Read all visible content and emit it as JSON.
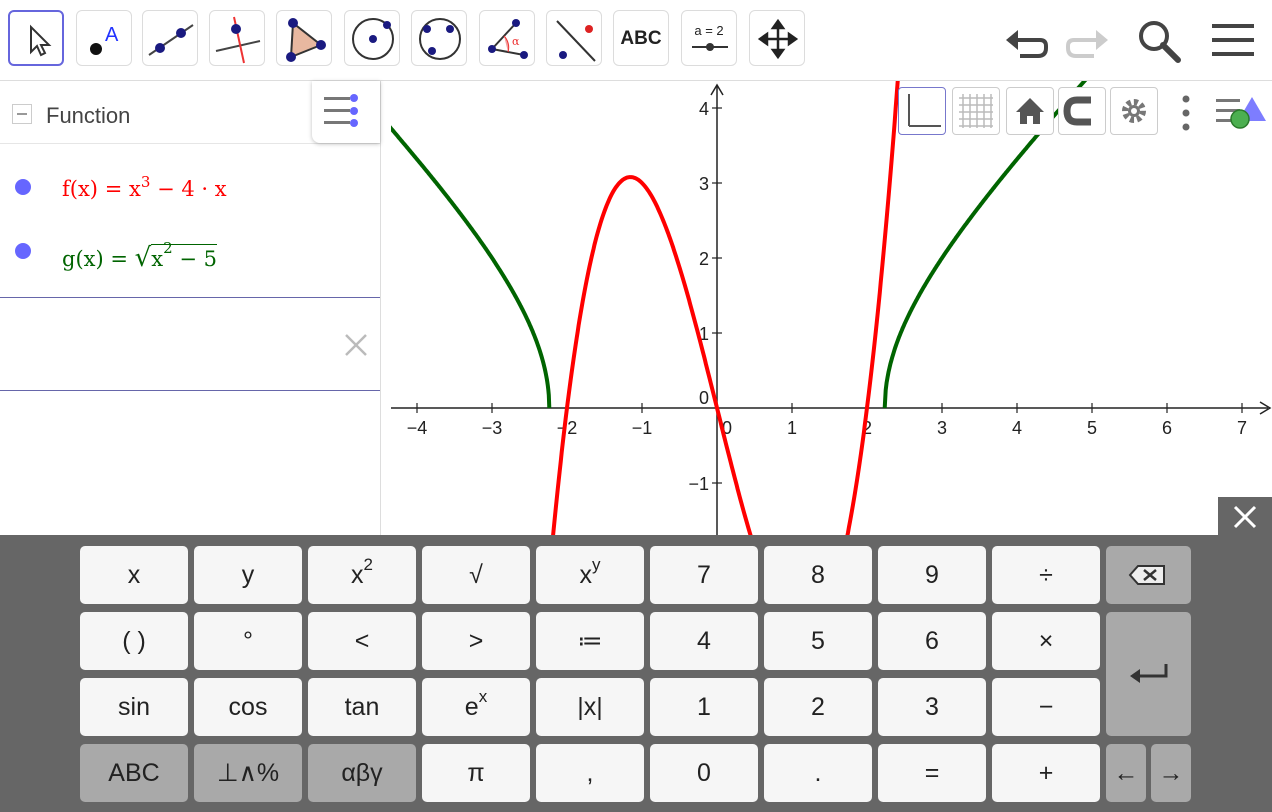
{
  "toolbar": {
    "tools": [
      "move-tool",
      "point-tool",
      "line-tool",
      "perpendicular-line-tool",
      "polygon-tool",
      "circle-center-point-tool",
      "circle-three-points-tool",
      "angle-tool",
      "reflect-about-line-tool",
      "text-tool",
      "slider-tool",
      "move-graphics-view-tool"
    ],
    "text_tool_label": "ABC",
    "slider_label": "a = 2"
  },
  "algebra": {
    "group_label": "Function",
    "f_name": "f(x)",
    "f_eq": "=",
    "f_rhs_base": "x",
    "f_rhs_exp": "3",
    "f_rhs_rest": "− 4 · x",
    "g_name": "g(x)",
    "g_eq": "=",
    "g_rad_base": "x",
    "g_rad_exp": "2",
    "g_rad_rest": "− 5",
    "input_value": ""
  },
  "graph": {
    "x_ticks": [
      "−4",
      "−3",
      "−2",
      "−1",
      "0",
      "1",
      "2",
      "3",
      "4",
      "5",
      "6",
      "7"
    ],
    "y_ticks": [
      "4",
      "3",
      "2",
      "1",
      "0",
      "−1"
    ],
    "colors": {
      "f": "#ff0000",
      "g": "#006400",
      "axis": "#222222"
    }
  },
  "chart_data": {
    "type": "line",
    "title": "",
    "xlabel": "",
    "ylabel": "",
    "xlim": [
      -4.4,
      7.3
    ],
    "ylim": [
      -1.7,
      4.3
    ],
    "series": [
      {
        "name": "f(x)",
        "expression": "x^3 - 4*x",
        "color": "#ff0000"
      },
      {
        "name": "g(x)",
        "expression": "sqrt(x^2 - 5)",
        "color": "#006400"
      }
    ]
  },
  "keyboard": {
    "rows": [
      [
        "x",
        "y",
        "x2",
        "√",
        "xy",
        "7",
        "8",
        "9",
        "÷",
        "⌫"
      ],
      [
        "( )",
        "°",
        "<",
        ">",
        "≔",
        "4",
        "5",
        "6",
        "×",
        "↵"
      ],
      [
        "sin",
        "cos",
        "tan",
        "ex",
        "|x|",
        "1",
        "2",
        "3",
        "−"
      ],
      [
        "ABC",
        "⊥∧%",
        "αβγ",
        "π",
        ",",
        "0",
        ".",
        "=",
        "+",
        "←",
        "→"
      ]
    ]
  }
}
